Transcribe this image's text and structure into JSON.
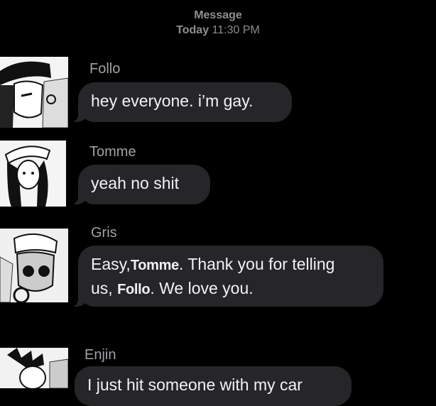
{
  "header": {
    "service": "Message",
    "day": "Today",
    "time": "11:30 PM"
  },
  "messages": [
    {
      "sender": "Follo",
      "text": "hey everyone. i’m gay."
    },
    {
      "sender": "Tomme",
      "text": "yeah no shit"
    },
    {
      "sender": "Gris",
      "parts": [
        "Easy,",
        "Tomme",
        ". Thank you for telling",
        "us,",
        "Follo",
        ". We love you."
      ]
    },
    {
      "sender": "Enjin",
      "text": "I just hit someone with my car"
    }
  ]
}
